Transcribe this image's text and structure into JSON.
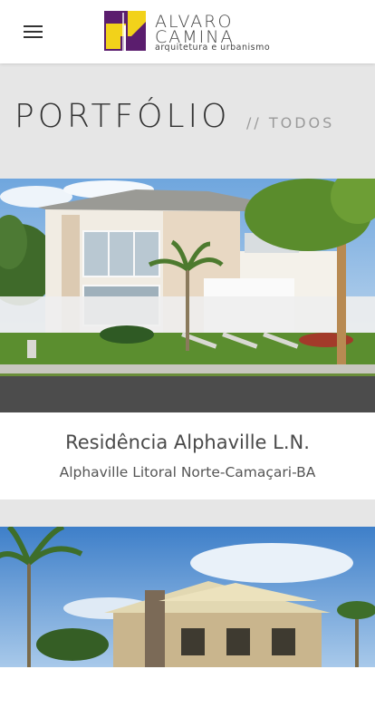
{
  "header": {
    "brand_line1": "ALVARO",
    "brand_line2": "CAMINA",
    "brand_tagline": "arquitetura e urbanismo"
  },
  "hero": {
    "title": "PORTFÓLIO",
    "filter": "// TODOS"
  },
  "projects": [
    {
      "title": "Residência Alphaville L.N.",
      "location": "Alphaville Litoral Norte-Camaçari-BA"
    }
  ],
  "colors": {
    "logo_purple": "#5b1d6e",
    "logo_yellow": "#f2d21a",
    "page_bg": "#e6e6e6"
  }
}
